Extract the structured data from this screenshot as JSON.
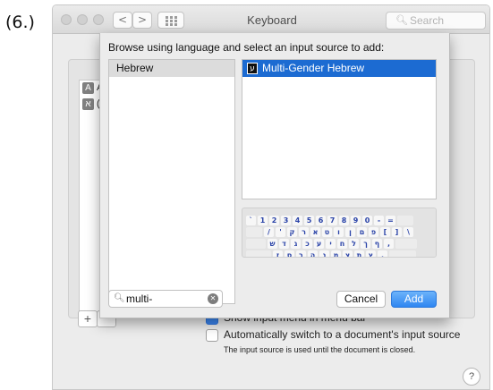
{
  "step_label": "(6.)",
  "window": {
    "title": "Keyboard",
    "search_placeholder": "Search",
    "nav_back": "<",
    "nav_forward": ">"
  },
  "background": {
    "source_icons": [
      "A",
      "א"
    ],
    "source_letters": [
      "A",
      "("
    ],
    "add_button": "+",
    "checkboxes": [
      {
        "label": "Show input menu in menu bar",
        "checked": true
      },
      {
        "label": "Automatically switch to a document's input source",
        "checked": false
      }
    ],
    "note": "The input source is used until the document is closed.",
    "help": "?"
  },
  "sheet": {
    "title": "Browse using language and select an input source to add:",
    "languages": [
      "Hebrew"
    ],
    "input_sources": [
      {
        "icon": "ע",
        "label": "Multi-Gender Hebrew",
        "selected": true
      }
    ],
    "keyboard_rows": [
      [
        "`",
        "1",
        "2",
        "3",
        "4",
        "5",
        "6",
        "7",
        "8",
        "9",
        "0",
        "-",
        "="
      ],
      [
        "/",
        "'",
        "ק",
        "ר",
        "א",
        "ט",
        "ו",
        "ן",
        "ם",
        "פ",
        "[",
        "]",
        "\\"
      ],
      [
        "ש",
        "ד",
        "ג",
        "כ",
        "ע",
        "י",
        "ח",
        "ל",
        "ך",
        "ף",
        ","
      ],
      [
        "ז",
        "ס",
        "ב",
        "ה",
        "נ",
        "מ",
        "צ",
        "ת",
        "ץ",
        "."
      ]
    ],
    "filter_value": "multi-",
    "cancel_label": "Cancel",
    "add_label": "Add"
  },
  "colors": {
    "accent": "#2f86f1",
    "selection": "#1c6bd2",
    "key_text": "#2a43a8"
  },
  "icons": {
    "search": "magnifier-icon",
    "clear": "clear-circle-icon",
    "help": "question-icon"
  }
}
